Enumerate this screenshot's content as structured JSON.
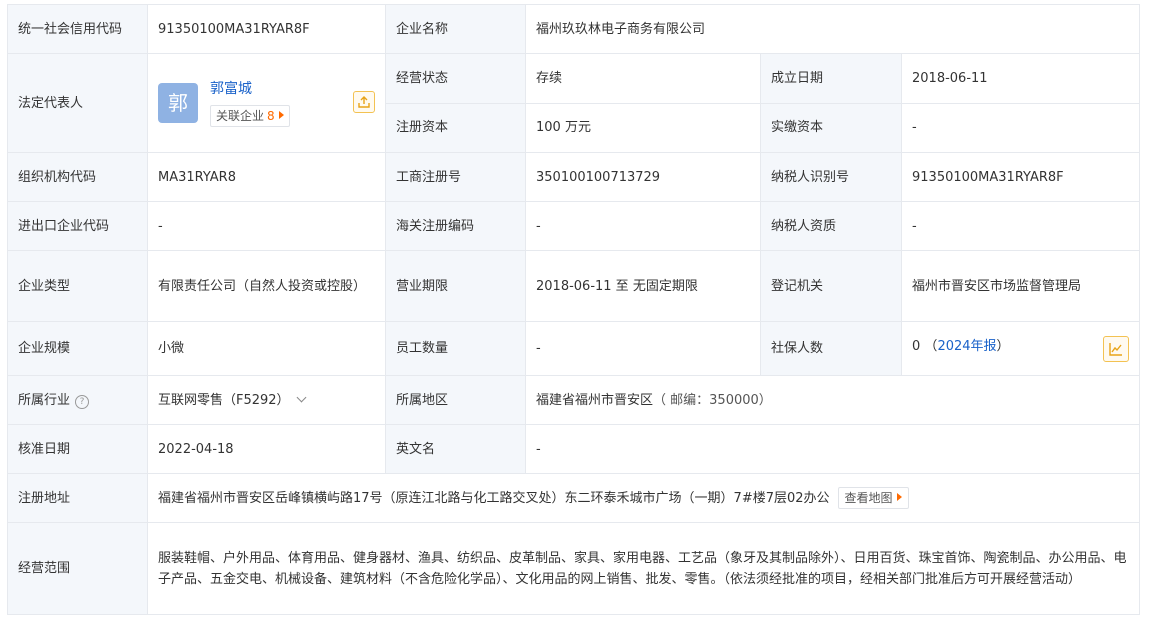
{
  "rows": {
    "credit_code": {
      "label": "统一社会信用代码",
      "value": "91350100MA31RYAR8F"
    },
    "company_name": {
      "label": "企业名称",
      "value": "福州玖玖林电子商务有限公司"
    },
    "legal_rep": {
      "label": "法定代表人",
      "avatar_char": "郭",
      "name": "郭富城",
      "related_label": "关联企业",
      "related_count": "8"
    },
    "status": {
      "label": "经营状态",
      "value": "存续"
    },
    "founded": {
      "label": "成立日期",
      "value": "2018-06-11"
    },
    "reg_capital": {
      "label": "注册资本",
      "value": "100 万元"
    },
    "paid_capital": {
      "label": "实缴资本",
      "value": "-"
    },
    "org_code": {
      "label": "组织机构代码",
      "value": "MA31RYAR8"
    },
    "biz_reg_no": {
      "label": "工商注册号",
      "value": "350100100713729"
    },
    "taxpayer_id": {
      "label": "纳税人识别号",
      "value": "91350100MA31RYAR8F"
    },
    "import_export": {
      "label": "进出口企业代码",
      "value": "-"
    },
    "customs_code": {
      "label": "海关注册编码",
      "value": "-"
    },
    "taxpayer_qual": {
      "label": "纳税人资质",
      "value": "-"
    },
    "company_type": {
      "label": "企业类型",
      "value": "有限责任公司（自然人投资或控股）"
    },
    "biz_term": {
      "label": "营业期限",
      "value": "2018-06-11 至 无固定期限"
    },
    "reg_authority": {
      "label": "登记机关",
      "value": "福州市晋安区市场监督管理局"
    },
    "scale": {
      "label": "企业规模",
      "value": "小微"
    },
    "employees": {
      "label": "员工数量",
      "value": "-"
    },
    "social_security": {
      "label": "社保人数",
      "value": "0",
      "paren_open": "（",
      "report": "2024年报",
      "paren_close": "）"
    },
    "industry": {
      "label": "所属行业",
      "help": "?",
      "value": "互联网零售（F5292）"
    },
    "region": {
      "label": "所属地区",
      "value": "福建省福州市晋安区",
      "postcode": "（ 邮编：350000）"
    },
    "approval_date": {
      "label": "核准日期",
      "value": "2022-04-18"
    },
    "english_name": {
      "label": "英文名",
      "value": "-"
    },
    "reg_address": {
      "label": "注册地址",
      "value": "福建省福州市晋安区岳峰镇横屿路17号（原连江北路与化工路交叉处）东二环泰禾城市广场（一期）7#楼7层02办公",
      "map_button": "查看地图"
    },
    "biz_scope": {
      "label": "经营范围",
      "value": "服装鞋帽、户外用品、体育用品、健身器材、渔具、纺织品、皮革制品、家具、家用电器、工艺品（象牙及其制品除外）、日用百货、珠宝首饰、陶瓷制品、办公用品、电子产品、五金交电、机械设备、建筑材料（不含危险化学品）、文化用品的网上销售、批发、零售。（依法须经批准的项目，经相关部门批准后方可开展经营活动）"
    }
  },
  "colors": {
    "label_bg": "#f4f7fb",
    "border": "#e6e9ee",
    "link_blue": "#1a62c9",
    "accent_orange": "#ff6a00",
    "icon_yellow": "#e8a317",
    "avatar_bg": "#8fb2e3"
  },
  "icons": {
    "share": "share-icon",
    "trend": "trend-chart-icon",
    "help": "help-icon",
    "chevron": "chevron-down-icon",
    "arrow": "arrow-right-icon"
  }
}
